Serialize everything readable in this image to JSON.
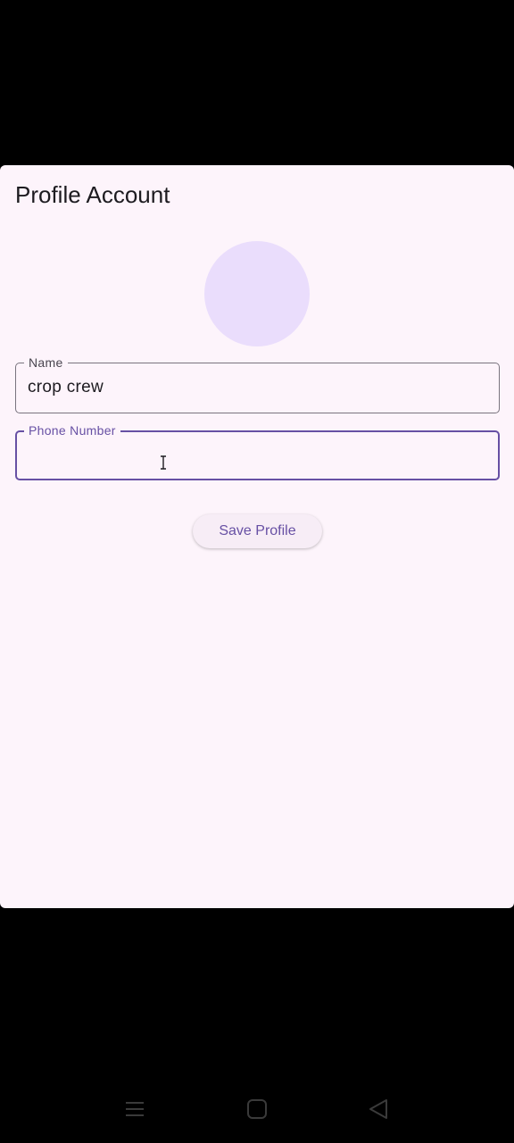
{
  "dialog": {
    "title": "Profile Account"
  },
  "form": {
    "name": {
      "label": "Name",
      "value": "crop crew"
    },
    "phone": {
      "label": "Phone Number",
      "value": ""
    },
    "save_label": "Save Profile"
  },
  "icons": {
    "text_cursor": "text-cursor-icon",
    "nav_menu": "menu-icon",
    "nav_home": "home-square-icon",
    "nav_back": "back-triangle-icon"
  },
  "colors": {
    "surface": "#fdf4fb",
    "accent": "#6750a4",
    "avatar": "#eaddfc",
    "outline": "#79747e",
    "nav_icon": "#3a3a3a"
  }
}
